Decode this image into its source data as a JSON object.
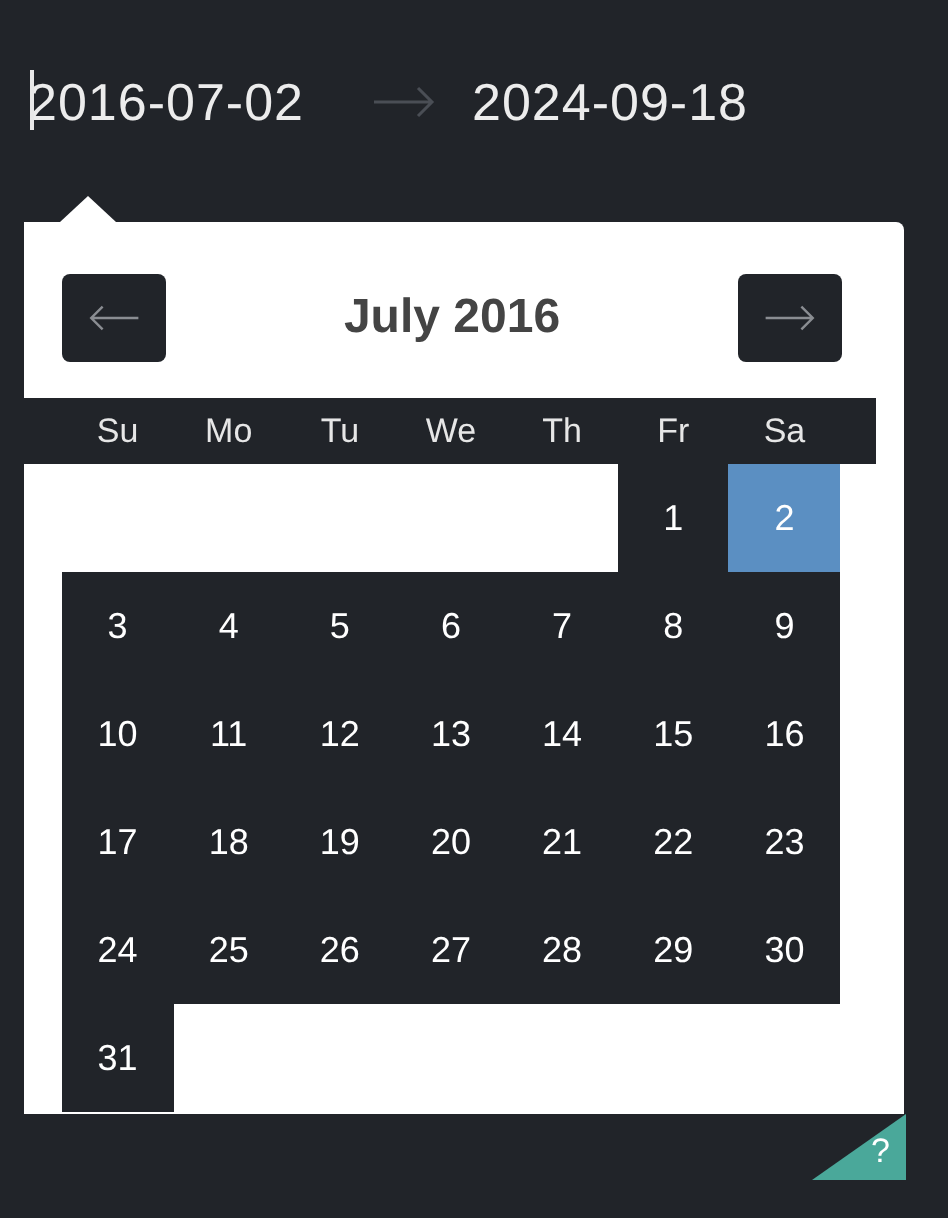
{
  "range": {
    "start": {
      "value": "2016-07-02",
      "focused": true
    },
    "end": {
      "value": "2024-09-18",
      "focused": false
    }
  },
  "calendar": {
    "title": "July 2016",
    "weekdays": [
      "Su",
      "Mo",
      "Tu",
      "We",
      "Th",
      "Fr",
      "Sa"
    ],
    "weeks": [
      [
        {
          "kind": "blank"
        },
        {
          "kind": "blank"
        },
        {
          "kind": "blank"
        },
        {
          "kind": "blank"
        },
        {
          "kind": "blank"
        },
        {
          "kind": "day",
          "label": "1",
          "selected": false
        },
        {
          "kind": "day",
          "label": "2",
          "selected": true
        }
      ],
      [
        {
          "kind": "day",
          "label": "3",
          "selected": false
        },
        {
          "kind": "day",
          "label": "4",
          "selected": false
        },
        {
          "kind": "day",
          "label": "5",
          "selected": false
        },
        {
          "kind": "day",
          "label": "6",
          "selected": false
        },
        {
          "kind": "day",
          "label": "7",
          "selected": false
        },
        {
          "kind": "day",
          "label": "8",
          "selected": false
        },
        {
          "kind": "day",
          "label": "9",
          "selected": false
        }
      ],
      [
        {
          "kind": "day",
          "label": "10",
          "selected": false
        },
        {
          "kind": "day",
          "label": "11",
          "selected": false
        },
        {
          "kind": "day",
          "label": "12",
          "selected": false
        },
        {
          "kind": "day",
          "label": "13",
          "selected": false
        },
        {
          "kind": "day",
          "label": "14",
          "selected": false
        },
        {
          "kind": "day",
          "label": "15",
          "selected": false
        },
        {
          "kind": "day",
          "label": "16",
          "selected": false
        }
      ],
      [
        {
          "kind": "day",
          "label": "17",
          "selected": false
        },
        {
          "kind": "day",
          "label": "18",
          "selected": false
        },
        {
          "kind": "day",
          "label": "19",
          "selected": false
        },
        {
          "kind": "day",
          "label": "20",
          "selected": false
        },
        {
          "kind": "day",
          "label": "21",
          "selected": false
        },
        {
          "kind": "day",
          "label": "22",
          "selected": false
        },
        {
          "kind": "day",
          "label": "23",
          "selected": false
        }
      ],
      [
        {
          "kind": "day",
          "label": "24",
          "selected": false
        },
        {
          "kind": "day",
          "label": "25",
          "selected": false
        },
        {
          "kind": "day",
          "label": "26",
          "selected": false
        },
        {
          "kind": "day",
          "label": "27",
          "selected": false
        },
        {
          "kind": "day",
          "label": "28",
          "selected": false
        },
        {
          "kind": "day",
          "label": "29",
          "selected": false
        },
        {
          "kind": "day",
          "label": "30",
          "selected": false
        }
      ],
      [
        {
          "kind": "day",
          "label": "31",
          "selected": false
        },
        {
          "kind": "blank"
        },
        {
          "kind": "blank"
        },
        {
          "kind": "blank"
        },
        {
          "kind": "blank"
        },
        {
          "kind": "blank"
        },
        {
          "kind": "blank"
        }
      ]
    ]
  },
  "help": {
    "label": "?"
  }
}
